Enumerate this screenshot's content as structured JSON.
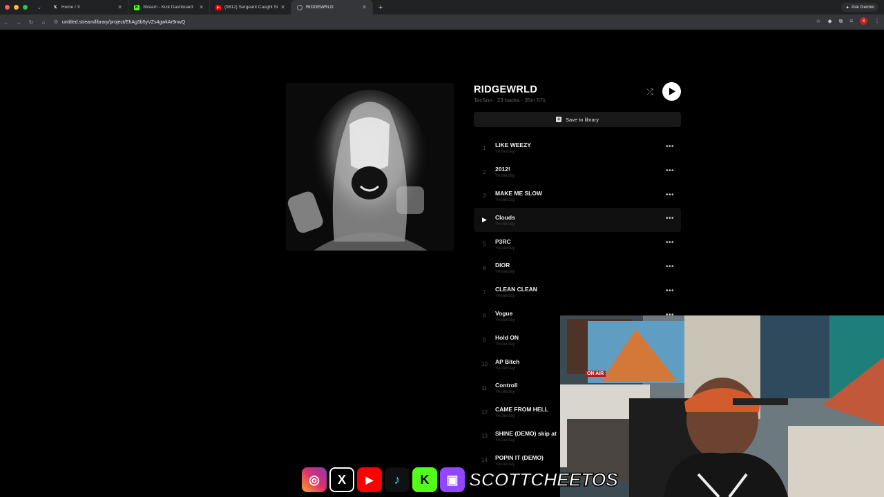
{
  "browser": {
    "tabs": [
      {
        "title": "Home / X",
        "favicon": "x-icon"
      },
      {
        "title": "Stream - Kick Dashboard",
        "favicon": "kick-icon"
      },
      {
        "title": "(9812) Sergeant Caught Stea",
        "favicon": "youtube-icon"
      },
      {
        "title": "RIDGEWRLD",
        "favicon": "globe-icon",
        "active": true
      }
    ],
    "new_tab": "+",
    "ask_gemini": "Ask Gemini",
    "url": "untitled.stream/library/project/EhAg5b5yVZs4gwkAr9nwQ",
    "profile_initial": "S"
  },
  "album": {
    "title": "RIDGEWRLD",
    "meta": "TecSon · 23 tracks · 35m 57s",
    "save_label": "Save to library"
  },
  "tracks": [
    {
      "num": "1",
      "name": "LIKE WEEZY",
      "sub": "Yesterday"
    },
    {
      "num": "2",
      "name": "2012!",
      "sub": "Yesterday"
    },
    {
      "num": "3",
      "name": "MAKE ME SLOW",
      "sub": "Yesterday"
    },
    {
      "num": "4",
      "name": "Clouds",
      "sub": "Yesterday",
      "hover": true
    },
    {
      "num": "5",
      "name": "P3RC",
      "sub": "Yesterday"
    },
    {
      "num": "6",
      "name": "DIOR",
      "sub": "Yesterday"
    },
    {
      "num": "7",
      "name": "CLEAN CLEAN",
      "sub": "Yesterday"
    },
    {
      "num": "8",
      "name": "Vogue",
      "sub": "Yesterday"
    },
    {
      "num": "9",
      "name": "Hold ON",
      "sub": "Yesterday"
    },
    {
      "num": "10",
      "name": "AP Bitch",
      "sub": "Yesterday"
    },
    {
      "num": "11",
      "name": "Controll",
      "sub": "Yesterday"
    },
    {
      "num": "12",
      "name": "CAME FROM HELL",
      "sub": "Yesterday"
    },
    {
      "num": "13",
      "name": "SHINE (DEMO) skip at",
      "sub": "Yesterday"
    },
    {
      "num": "14",
      "name": "POPIN IT (DEMO)",
      "sub": "Yesterday"
    }
  ],
  "overlay": {
    "handle": "SCOTTCHEETOS",
    "on_air": "ON AIR",
    "icons": [
      "instagram-icon",
      "x-icon",
      "youtube-icon",
      "tiktok-icon",
      "kick-icon",
      "twitch-icon"
    ]
  },
  "colors": {
    "accent": "#ffffff",
    "background": "#000000"
  }
}
